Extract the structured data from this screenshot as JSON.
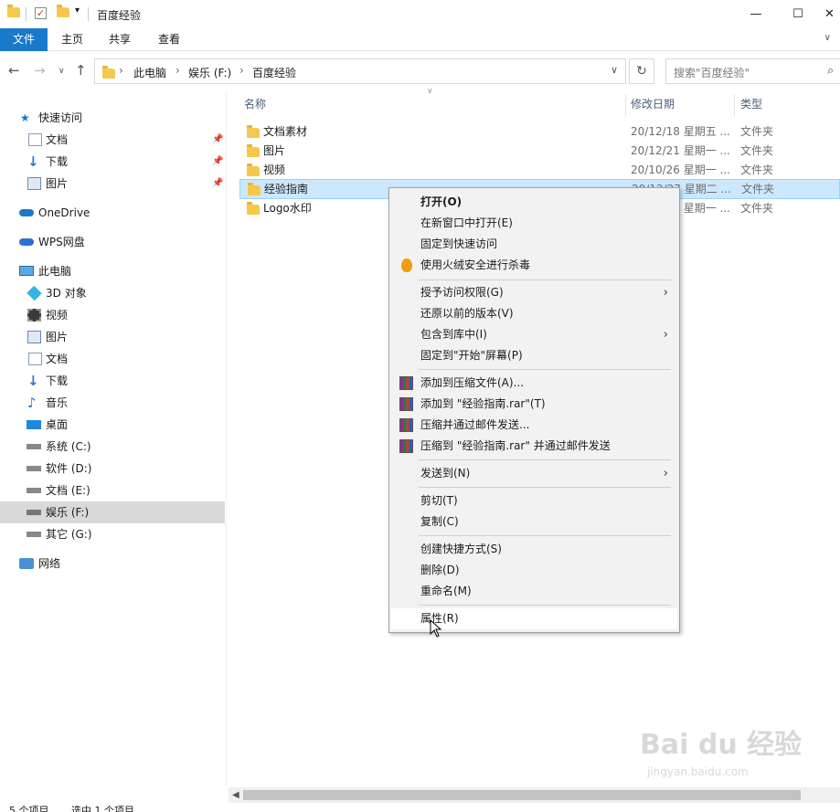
{
  "titlebar": {
    "title": "百度经验",
    "minimize": "—",
    "maximize": "☐",
    "close": "✕"
  },
  "ribbon": {
    "tabs": [
      "文件",
      "主页",
      "共享",
      "查看"
    ]
  },
  "address": {
    "crumbs": [
      "此电脑",
      "娱乐 (F:)",
      "百度经验"
    ],
    "search_placeholder": "搜索\"百度经验\""
  },
  "navpane": {
    "items": [
      {
        "label": "快速访问",
        "icon": "star-icon"
      },
      {
        "label": "文档",
        "icon": "document-icon",
        "pinned": true
      },
      {
        "label": "下载",
        "icon": "download-icon",
        "pinned": true
      },
      {
        "label": "图片",
        "icon": "picture-icon",
        "pinned": true
      },
      {
        "label": "OneDrive",
        "icon": "cloud-icon"
      },
      {
        "label": "WPS网盘",
        "icon": "cloud-icon"
      },
      {
        "label": "此电脑",
        "icon": "computer-icon"
      },
      {
        "label": "3D 对象",
        "icon": "cube-icon"
      },
      {
        "label": "视频",
        "icon": "film-icon"
      },
      {
        "label": "图片",
        "icon": "picture-icon"
      },
      {
        "label": "文档",
        "icon": "document-icon"
      },
      {
        "label": "下载",
        "icon": "download-icon"
      },
      {
        "label": "音乐",
        "icon": "music-icon"
      },
      {
        "label": "桌面",
        "icon": "desktop-icon"
      },
      {
        "label": "系统 (C:)",
        "icon": "drive-icon"
      },
      {
        "label": "软件 (D:)",
        "icon": "drive-icon"
      },
      {
        "label": "文档 (E:)",
        "icon": "drive-icon"
      },
      {
        "label": "娱乐 (F:)",
        "icon": "drive-icon",
        "selected": true
      },
      {
        "label": "其它 (G:)",
        "icon": "drive-icon"
      },
      {
        "label": "网络",
        "icon": "network-icon"
      }
    ]
  },
  "filelist": {
    "columns": {
      "name": "名称",
      "date": "修改日期",
      "type": "类型"
    },
    "rows": [
      {
        "name": "文档素材",
        "date": "20/12/18 星期五 ...",
        "type": "文件夹"
      },
      {
        "name": "图片",
        "date": "20/12/21 星期一 ...",
        "type": "文件夹"
      },
      {
        "name": "视频",
        "date": "20/10/26 星期一 ...",
        "type": "文件夹"
      },
      {
        "name": "经验指南",
        "date": "20/12/27 星期二 ...",
        "type": "文件夹",
        "selected": true
      },
      {
        "name": "Logo水印",
        "date": "20/12/21 星期一 ...",
        "type": "文件夹"
      }
    ]
  },
  "context_menu": {
    "items": [
      {
        "label": "打开(O)",
        "bold": true
      },
      {
        "label": "在新窗口中打开(E)"
      },
      {
        "label": "固定到快速访问"
      },
      {
        "label": "使用火绒安全进行杀毒",
        "icon": "fire-icon"
      },
      {
        "separator": true
      },
      {
        "label": "授予访问权限(G)",
        "submenu": true
      },
      {
        "label": "还原以前的版本(V)"
      },
      {
        "label": "包含到库中(I)",
        "submenu": true
      },
      {
        "label": "固定到\"开始\"屏幕(P)"
      },
      {
        "separator": true
      },
      {
        "label": "添加到压缩文件(A)...",
        "icon": "rar-icon"
      },
      {
        "label": "添加到 \"经验指南.rar\"(T)",
        "icon": "rar-icon"
      },
      {
        "label": "压缩并通过邮件发送...",
        "icon": "rar-icon"
      },
      {
        "label": "压缩到 \"经验指南.rar\" 并通过邮件发送",
        "icon": "rar-icon"
      },
      {
        "separator": true
      },
      {
        "label": "发送到(N)",
        "submenu": true
      },
      {
        "separator": true
      },
      {
        "label": "剪切(T)"
      },
      {
        "label": "复制(C)"
      },
      {
        "separator": true
      },
      {
        "label": "创建快捷方式(S)"
      },
      {
        "label": "删除(D)"
      },
      {
        "label": "重命名(M)"
      },
      {
        "separator": true
      },
      {
        "label": "属性(R)",
        "hover": true
      }
    ]
  },
  "status": {
    "count": "5 个项目",
    "selected": "选中 1 个项目"
  },
  "watermark": {
    "brand": "Bai du 经验",
    "url": "jingyan.baidu.com"
  }
}
